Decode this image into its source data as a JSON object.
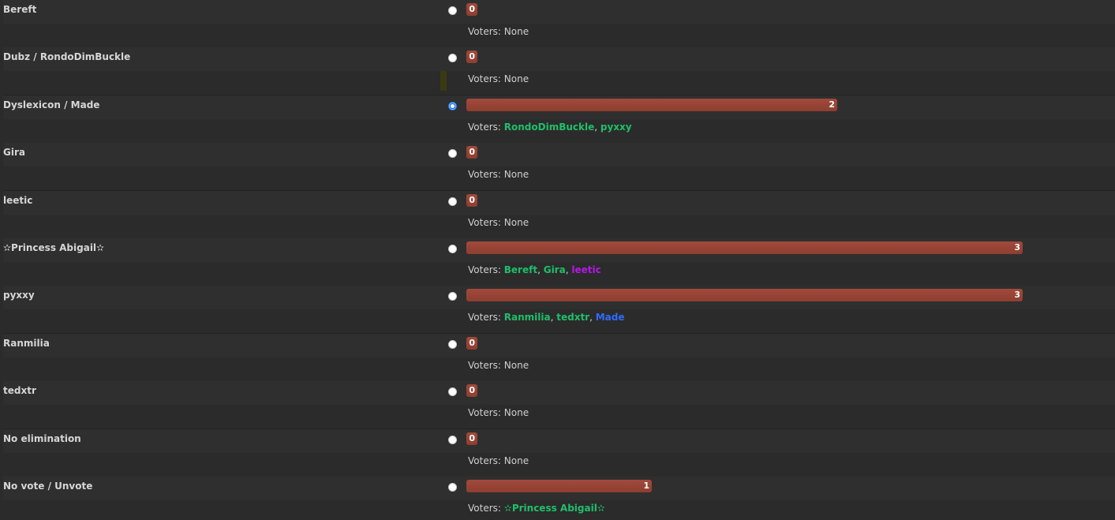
{
  "voters_label": "Voters:",
  "max_votes": 3,
  "options": [
    {
      "name": "Bereft",
      "votes": 0,
      "checked": false,
      "voters": []
    },
    {
      "name": "Dubz / RondoDimBuckle",
      "votes": 0,
      "checked": false,
      "voters": [],
      "marker": true
    },
    {
      "name": "Dyslexicon / Made",
      "votes": 2,
      "checked": true,
      "voters": [
        {
          "name": "RondoDimBuckle",
          "color": "#1fbf6a"
        },
        {
          "name": "pyxxy",
          "color": "#1fbf6a"
        }
      ]
    },
    {
      "name": "Gira",
      "votes": 0,
      "checked": false,
      "voters": []
    },
    {
      "name": "leetic",
      "votes": 0,
      "checked": false,
      "voters": []
    },
    {
      "name": "✫Princess Abigail✫",
      "votes": 3,
      "checked": false,
      "voters": [
        {
          "name": "Bereft",
          "color": "#1fbf6a"
        },
        {
          "name": "Gira",
          "color": "#1fbf6a"
        },
        {
          "name": "leetic",
          "color": "#b517e8"
        }
      ]
    },
    {
      "name": "pyxxy",
      "votes": 3,
      "checked": false,
      "voters": [
        {
          "name": "Ranmilia",
          "color": "#1fbf6a"
        },
        {
          "name": "tedxtr",
          "color": "#1fbf6a"
        },
        {
          "name": "Made",
          "color": "#2f6bff"
        }
      ]
    },
    {
      "name": "Ranmilia",
      "votes": 0,
      "checked": false,
      "voters": []
    },
    {
      "name": "tedxtr",
      "votes": 0,
      "checked": false,
      "voters": []
    },
    {
      "name": "No elimination",
      "votes": 0,
      "checked": false,
      "voters": []
    },
    {
      "name": "No vote / Unvote",
      "votes": 1,
      "checked": false,
      "voters": [
        {
          "name": "✫Princess Abigail✫",
          "color": "#1fbf6a"
        }
      ]
    }
  ],
  "none_label": "None"
}
